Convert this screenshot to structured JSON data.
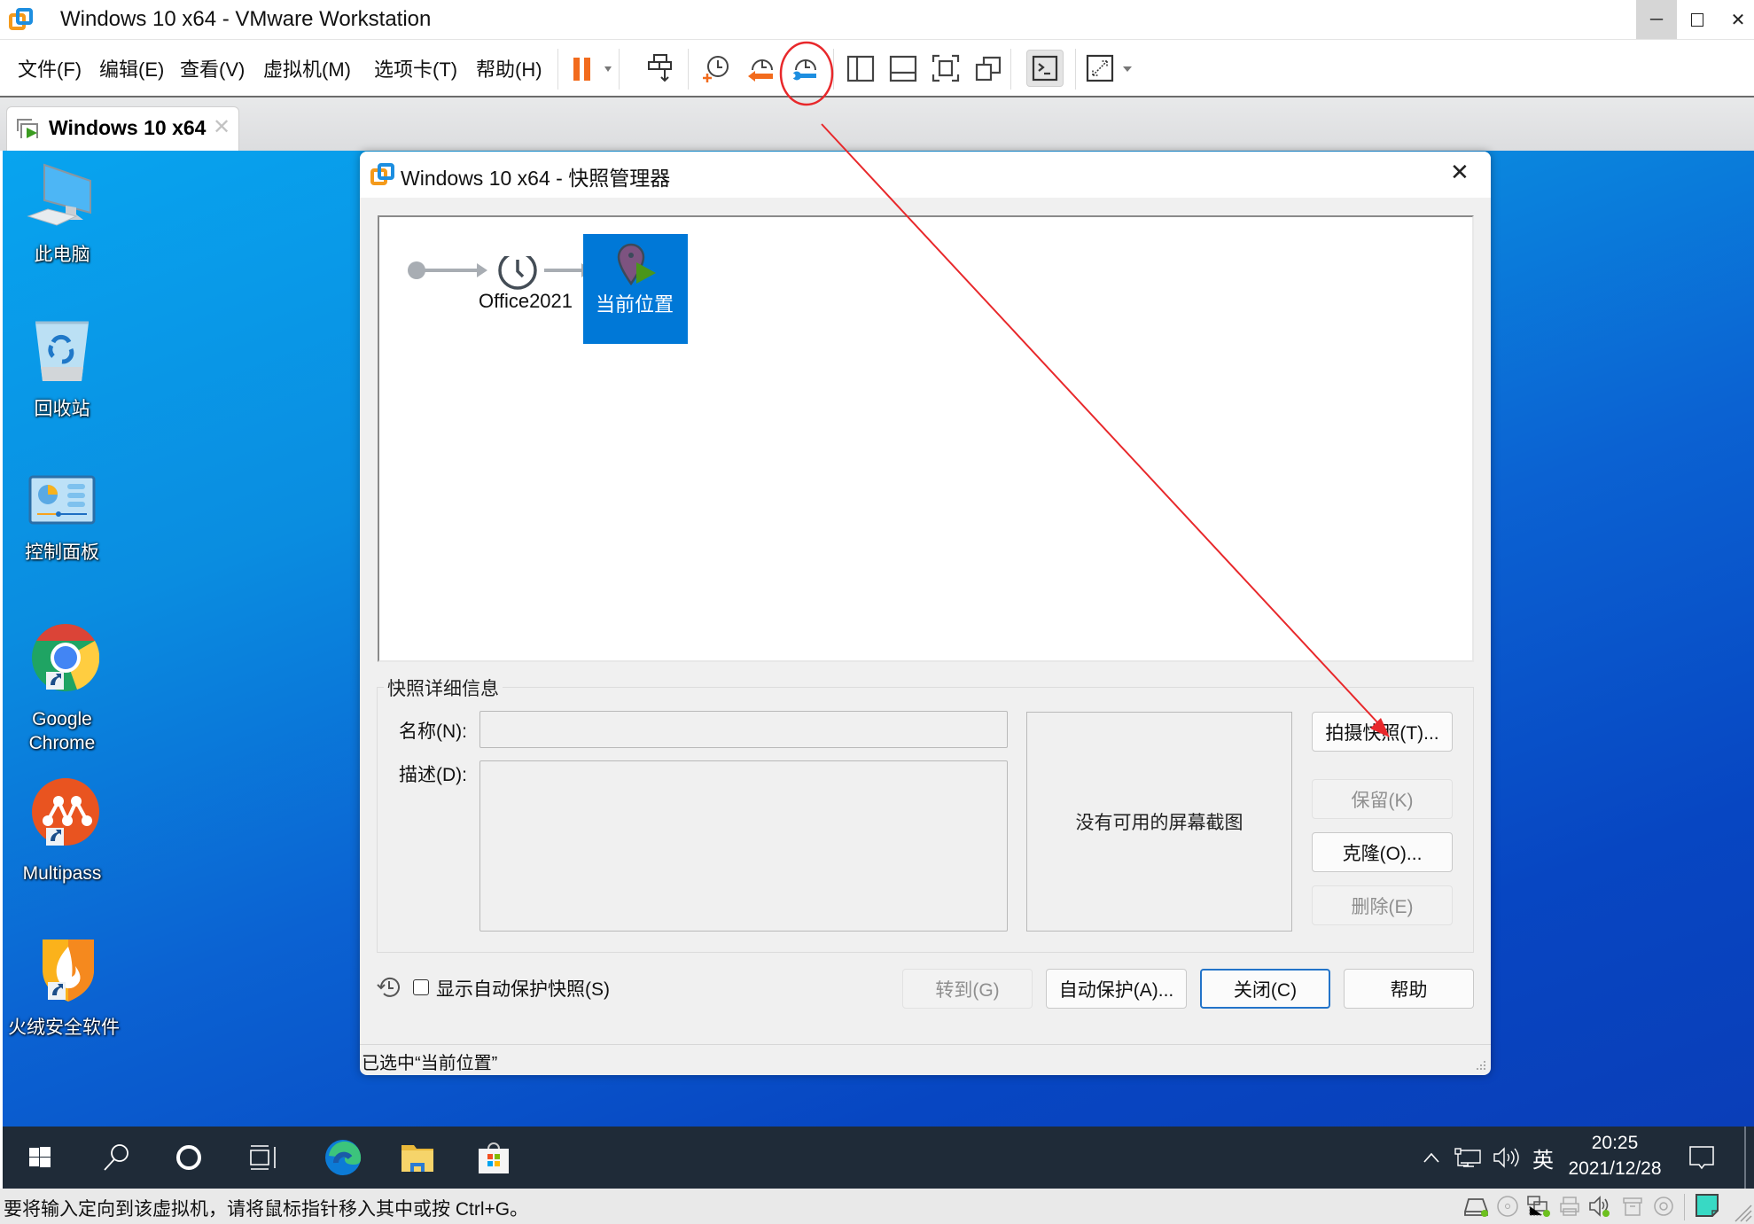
{
  "app": {
    "title": "Windows 10 x64 - VMware Workstation",
    "window_controls": {
      "minimize": "minimize-icon",
      "maximize": "maximize-icon",
      "close": "close-icon"
    }
  },
  "menu": [
    {
      "label": "文件(F)"
    },
    {
      "label": "编辑(E)"
    },
    {
      "label": "查看(V)"
    },
    {
      "label": "虚拟机(M)"
    },
    {
      "label": "选项卡(T)"
    },
    {
      "label": "帮助(H)"
    }
  ],
  "toolbar": [
    {
      "icon": "pause-icon",
      "color": "#f26b1d"
    },
    {
      "icon": "send-ctrl-alt-del-icon"
    },
    {
      "icon": "take-snapshot-icon"
    },
    {
      "icon": "revert-snapshot-icon"
    },
    {
      "icon": "snapshot-manager-icon",
      "highlighted": true
    },
    {
      "icon": "show-library-icon"
    },
    {
      "icon": "show-thumbnail-bar-icon"
    },
    {
      "icon": "full-screen-icon"
    },
    {
      "icon": "unity-icon"
    },
    {
      "icon": "console-view-icon"
    },
    {
      "icon": "stretch-guest-icon"
    }
  ],
  "tab": {
    "label": "Windows 10 x64"
  },
  "desktop_icons": [
    {
      "label": "此电脑",
      "icon": "this-pc-icon"
    },
    {
      "label": "回收站",
      "icon": "recycle-bin-icon"
    },
    {
      "label": "控制面板",
      "icon": "control-panel-icon"
    },
    {
      "label": "Google Chrome",
      "label_line1": "Google",
      "label_line2": "Chrome",
      "icon": "chrome-icon"
    },
    {
      "label": "Multipass",
      "icon": "multipass-icon"
    },
    {
      "label": "火绒安全软件",
      "icon": "huorong-icon"
    }
  ],
  "dialog": {
    "title": "Windows 10 x64 - 快照管理器",
    "tree": {
      "snapshot_name": "Office2021",
      "current_label": "当前位置"
    },
    "details": {
      "group_label": "快照详细信息",
      "name_label": "名称(N):",
      "name_value": "",
      "description_label": "描述(D):",
      "description_value": "",
      "no_screenshot": "没有可用的屏幕截图"
    },
    "side_buttons": {
      "take_snapshot": "拍摄快照(T)...",
      "keep": "保留(K)",
      "clone": "克隆(O)...",
      "delete": "删除(E)"
    },
    "show_autoprotect_label": "显示自动保护快照(S)",
    "show_autoprotect_checked": false,
    "bottom_buttons": {
      "goto": "转到(G)",
      "autoprotect": "自动保护(A)...",
      "close": "关闭(C)",
      "help": "帮助"
    },
    "status": "已选中“当前位置”"
  },
  "annotation": {
    "color": "#e8282b"
  },
  "taskbar": {
    "apps": [
      "start-icon",
      "search-icon",
      "cortana-icon",
      "task-view-icon",
      "edge-icon",
      "file-explorer-icon",
      "store-icon"
    ],
    "ime": "英",
    "time": "20:25",
    "date": "2021/12/28"
  },
  "statusbar": {
    "message": "要将输入定向到该虚拟机，请将鼠标指针移入其中或按 Ctrl+G。",
    "devices": [
      "hard-disk-icon",
      "cd-dvd-icon",
      "network-adapter-icon",
      "printer-icon",
      "sound-card-icon",
      "usb-controller-icon",
      "camera-icon",
      "message-log-icon"
    ]
  }
}
